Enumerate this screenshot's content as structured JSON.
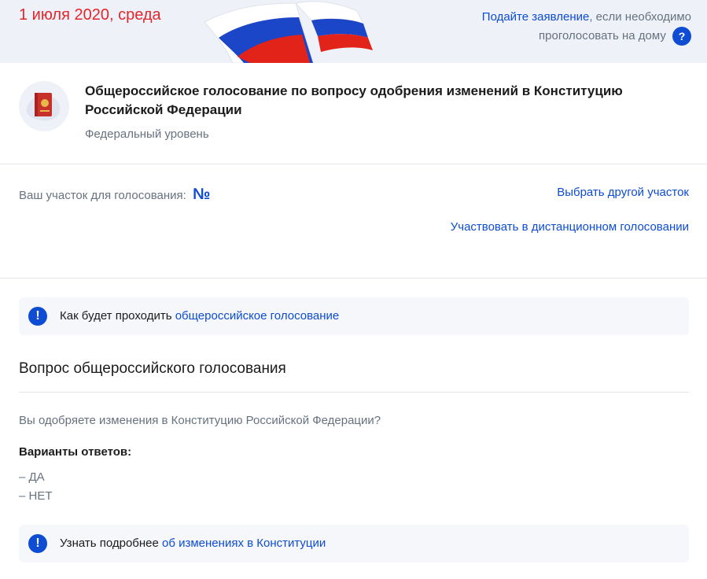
{
  "banner": {
    "date": "1 июля 2020, среда",
    "apply_link": "Подайте заявление",
    "apply_rest_line1": ", если необходимо",
    "apply_rest_line2": "проголосовать на дому",
    "help_icon": "question-icon",
    "help_glyph": "?"
  },
  "vote": {
    "title": "Общероссийское голосование по вопросу одобрения изменений в Конституцию Российской Федерации",
    "level": "Федеральный уровень",
    "emblem_icon": "constitution-book-icon"
  },
  "station": {
    "label": "Ваш участок для голосования:",
    "number_sign": "№",
    "choose_other_link": "Выбрать другой участок",
    "remote_link": "Участвовать в дистанционном голосовании"
  },
  "info1": {
    "icon": "exclamation-icon",
    "glyph": "!",
    "text": "Как будет проходить ",
    "link": "общероссийское голосование"
  },
  "question": {
    "heading": "Вопрос общероссийского голосования",
    "text": "Вы одобряете изменения в Конституцию Российской Федерации?",
    "options_heading": "Варианты ответов:",
    "options": [
      "–  ДА",
      "–  НЕТ"
    ]
  },
  "info2": {
    "icon": "exclamation-icon",
    "glyph": "!",
    "text": "Узнать подробнее ",
    "link": "об изменениях в Конституции"
  },
  "colors": {
    "accent": "#0d4cd3",
    "date_red": "#e3262b",
    "muted_text": "#66727f",
    "banner_bg": "#eef1f7",
    "info_bg": "#f5f7fa"
  }
}
